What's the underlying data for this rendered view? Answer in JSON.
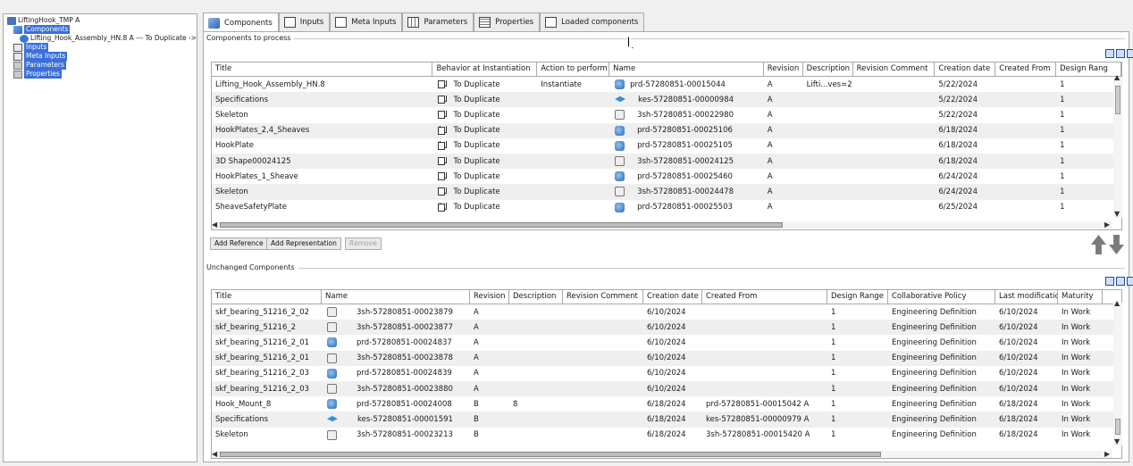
{
  "tree": {
    "items": [
      {
        "label": "LiftingHook_TMP A",
        "icon": "hook-template-icon",
        "indent": 0,
        "selected": false
      },
      {
        "label": "Components",
        "icon": "components-folder-icon",
        "indent": 1,
        "selected": true
      },
      {
        "label": "Lifting_Hook_Assembly_HN.8 A --- To Duplicate ->",
        "icon": "assembly-icon",
        "indent": 2,
        "selected": false
      },
      {
        "label": "Inputs",
        "icon": "inputs-icon",
        "indent": 1,
        "selected": true
      },
      {
        "label": "Meta Inputs",
        "icon": "meta-inputs-icon",
        "indent": 1,
        "selected": true
      },
      {
        "label": "Parameters",
        "icon": "parameters-icon",
        "indent": 1,
        "selected": true
      },
      {
        "label": "Properties",
        "icon": "properties-icon",
        "indent": 1,
        "selected": true
      }
    ]
  },
  "tabs": [
    {
      "label": "Components",
      "icon": "components-tab-icon",
      "active": true
    },
    {
      "label": "Inputs",
      "icon": "inputs-tab-icon",
      "active": false
    },
    {
      "label": "Meta Inputs",
      "icon": "meta-inputs-tab-icon",
      "active": false
    },
    {
      "label": "Parameters",
      "icon": "parameters-tab-icon",
      "active": false
    },
    {
      "label": "Properties",
      "icon": "properties-tab-icon",
      "active": false
    },
    {
      "label": "Loaded components",
      "icon": "loaded-components-tab-icon",
      "active": false
    }
  ],
  "to_process": {
    "group_label": "Components to process",
    "columns": [
      "Title",
      "Behavior at Instantiation",
      "Action to perform",
      "Name",
      "Revision",
      "Description",
      "Revision Comment",
      "Creation date",
      "Created From",
      "Design Rang"
    ],
    "rows": [
      {
        "title": "Lifting_Hook_Assembly_HN.8",
        "behavior": "To Duplicate",
        "action": "Instantiate",
        "icon": "prd",
        "name": "prd-57280851-00015044",
        "revision": "A",
        "description": "Lifti...ves=2",
        "rev_comment": "",
        "creation": "5/22/2024",
        "from": "",
        "range": "1"
      },
      {
        "title": "Specifications",
        "behavior": "To Duplicate",
        "action": "",
        "icon": "kes",
        "name": "kes-57280851-00000984",
        "revision": "A",
        "description": "",
        "rev_comment": "",
        "creation": "5/22/2024",
        "from": "",
        "range": "1"
      },
      {
        "title": "Skeleton",
        "behavior": "To Duplicate",
        "action": "",
        "icon": "3sh",
        "name": "3sh-57280851-00022980",
        "revision": "A",
        "description": "",
        "rev_comment": "",
        "creation": "5/22/2024",
        "from": "",
        "range": "1"
      },
      {
        "title": "HookPlates_2,4_Sheaves",
        "behavior": "To Duplicate",
        "action": "",
        "icon": "prd",
        "name": "prd-57280851-00025106",
        "revision": "A",
        "description": "",
        "rev_comment": "",
        "creation": "6/18/2024",
        "from": "",
        "range": "1"
      },
      {
        "title": "HookPlate",
        "behavior": "To Duplicate",
        "action": "",
        "icon": "prd",
        "name": "prd-57280851-00025105",
        "revision": "A",
        "description": "",
        "rev_comment": "",
        "creation": "6/18/2024",
        "from": "",
        "range": "1"
      },
      {
        "title": "3D Shape00024125",
        "behavior": "To Duplicate",
        "action": "",
        "icon": "3sh",
        "name": "3sh-57280851-00024125",
        "revision": "A",
        "description": "",
        "rev_comment": "",
        "creation": "6/18/2024",
        "from": "",
        "range": "1"
      },
      {
        "title": "HookPlates_1_Sheave",
        "behavior": "To Duplicate",
        "action": "",
        "icon": "prd",
        "name": "prd-57280851-00025460",
        "revision": "A",
        "description": "",
        "rev_comment": "",
        "creation": "6/24/2024",
        "from": "",
        "range": "1"
      },
      {
        "title": "Skeleton",
        "behavior": "To Duplicate",
        "action": "",
        "icon": "3sh",
        "name": "3sh-57280851-00024478",
        "revision": "A",
        "description": "",
        "rev_comment": "",
        "creation": "6/24/2024",
        "from": "",
        "range": "1"
      },
      {
        "title": "SheaveSafetyPlate",
        "behavior": "To Duplicate",
        "action": "",
        "icon": "prd",
        "name": "prd-57280851-00025503",
        "revision": "A",
        "description": "",
        "rev_comment": "",
        "creation": "6/25/2024",
        "from": "",
        "range": "1"
      }
    ]
  },
  "buttons": {
    "add_reference": "Add Reference",
    "add_representation": "Add Representation",
    "remove": "Remove"
  },
  "unchanged": {
    "group_label": "Unchanged Components",
    "columns": [
      "Title",
      "Name",
      "Revision",
      "Description",
      "Revision Comment",
      "Creation date",
      "Created From",
      "Design Range",
      "Collaborative Policy",
      "Last modification",
      "Maturity"
    ],
    "rows": [
      {
        "title": "skf_bearing_51216_2_02",
        "icon": "3sh",
        "name": "3sh-57280851-00023879",
        "revision": "A",
        "description": "",
        "rev_comment": "",
        "creation": "6/10/2024",
        "from": "",
        "range": "1",
        "policy": "Engineering Definition",
        "modified": "6/10/2024",
        "maturity": "In Work"
      },
      {
        "title": "skf_bearing_51216_2",
        "icon": "3sh",
        "name": "3sh-57280851-00023877",
        "revision": "A",
        "description": "",
        "rev_comment": "",
        "creation": "6/10/2024",
        "from": "",
        "range": "1",
        "policy": "Engineering Definition",
        "modified": "6/10/2024",
        "maturity": "In Work"
      },
      {
        "title": "skf_bearing_51216_2_01",
        "icon": "prd",
        "name": "prd-57280851-00024837",
        "revision": "A",
        "description": "",
        "rev_comment": "",
        "creation": "6/10/2024",
        "from": "",
        "range": "1",
        "policy": "Engineering Definition",
        "modified": "6/10/2024",
        "maturity": "In Work"
      },
      {
        "title": "skf_bearing_51216_2_01",
        "icon": "3sh",
        "name": "3sh-57280851-00023878",
        "revision": "A",
        "description": "",
        "rev_comment": "",
        "creation": "6/10/2024",
        "from": "",
        "range": "1",
        "policy": "Engineering Definition",
        "modified": "6/10/2024",
        "maturity": "In Work"
      },
      {
        "title": "skf_bearing_51216_2_03",
        "icon": "prd",
        "name": "prd-57280851-00024839",
        "revision": "A",
        "description": "",
        "rev_comment": "",
        "creation": "6/10/2024",
        "from": "",
        "range": "1",
        "policy": "Engineering Definition",
        "modified": "6/10/2024",
        "maturity": "In Work"
      },
      {
        "title": "skf_bearing_51216_2_03",
        "icon": "3sh",
        "name": "3sh-57280851-00023880",
        "revision": "A",
        "description": "",
        "rev_comment": "",
        "creation": "6/10/2024",
        "from": "",
        "range": "1",
        "policy": "Engineering Definition",
        "modified": "6/10/2024",
        "maturity": "In Work"
      },
      {
        "title": "Hook_Mount_8",
        "icon": "prd",
        "name": "prd-57280851-00024008",
        "revision": "B",
        "description": "8",
        "rev_comment": "",
        "creation": "6/18/2024",
        "from": "prd-57280851-00015042 A",
        "range": "1",
        "policy": "Engineering Definition",
        "modified": "6/18/2024",
        "maturity": "In Work"
      },
      {
        "title": "Specifications",
        "icon": "kes",
        "name": "kes-57280851-00001591",
        "revision": "B",
        "description": "",
        "rev_comment": "",
        "creation": "6/18/2024",
        "from": "kes-57280851-00000979 A",
        "range": "1",
        "policy": "Engineering Definition",
        "modified": "6/18/2024",
        "maturity": "In Work"
      },
      {
        "title": "Skeleton",
        "icon": "3sh",
        "name": "3sh-57280851-00023213",
        "revision": "B",
        "description": "",
        "rev_comment": "",
        "creation": "6/18/2024",
        "from": "3sh-57280851-00015420 A",
        "range": "1",
        "policy": "Engineering Definition",
        "modified": "6/18/2024",
        "maturity": "In Work"
      }
    ]
  },
  "colors": {
    "selection": "#3a6fd8",
    "row_alt": "#efefef",
    "accent_icon": "#2b68b5"
  }
}
